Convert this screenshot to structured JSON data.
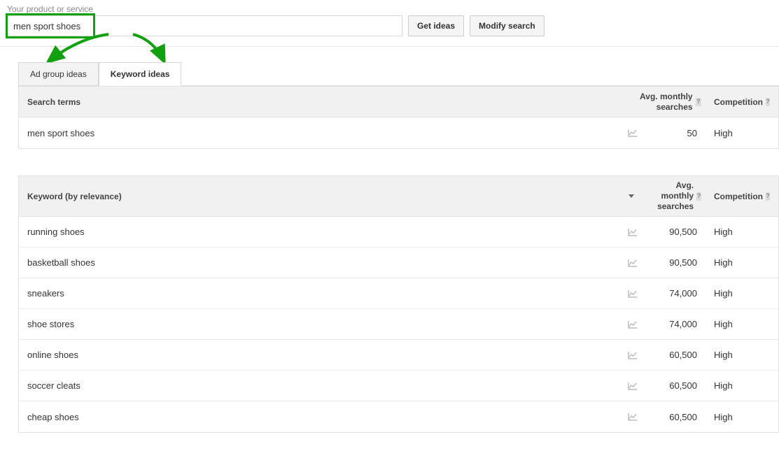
{
  "search": {
    "label": "Your product or service",
    "value": "men sport shoes"
  },
  "buttons": {
    "get_ideas": "Get ideas",
    "modify_search": "Modify search"
  },
  "tabs": {
    "ad_group": "Ad group ideas",
    "keyword": "Keyword ideas"
  },
  "table1": {
    "head_term": "Search terms",
    "head_search": "Avg. monthly searches",
    "head_comp": "Competition",
    "rows": [
      {
        "term": "men sport shoes",
        "searches": "50",
        "competition": "High"
      }
    ]
  },
  "table2": {
    "head_term": "Keyword (by relevance)",
    "head_search": "Avg. monthly searches",
    "head_comp": "Competition",
    "rows": [
      {
        "term": "running shoes",
        "searches": "90,500",
        "competition": "High"
      },
      {
        "term": "basketball shoes",
        "searches": "90,500",
        "competition": "High"
      },
      {
        "term": "sneakers",
        "searches": "74,000",
        "competition": "High"
      },
      {
        "term": "shoe stores",
        "searches": "74,000",
        "competition": "High"
      },
      {
        "term": "online shoes",
        "searches": "60,500",
        "competition": "High"
      },
      {
        "term": "soccer cleats",
        "searches": "60,500",
        "competition": "High"
      },
      {
        "term": "cheap shoes",
        "searches": "60,500",
        "competition": "High"
      }
    ]
  },
  "chart_data": {
    "type": "table",
    "title": "Keyword Planner — Keyword ideas for: men sport shoes",
    "search_terms": {
      "columns": [
        "Search term",
        "Avg. monthly searches",
        "Competition"
      ],
      "rows": [
        [
          "men sport shoes",
          50,
          "High"
        ]
      ]
    },
    "keyword_ideas": {
      "columns": [
        "Keyword (by relevance)",
        "Avg. monthly searches",
        "Competition"
      ],
      "sort": {
        "column": "Avg. monthly searches",
        "direction": "desc"
      },
      "rows": [
        [
          "running shoes",
          90500,
          "High"
        ],
        [
          "basketball shoes",
          90500,
          "High"
        ],
        [
          "sneakers",
          74000,
          "High"
        ],
        [
          "shoe stores",
          74000,
          "High"
        ],
        [
          "online shoes",
          60500,
          "High"
        ],
        [
          "soccer cleats",
          60500,
          "High"
        ],
        [
          "cheap shoes",
          60500,
          "High"
        ]
      ]
    }
  }
}
